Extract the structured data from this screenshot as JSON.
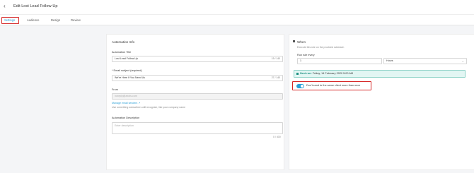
{
  "header": {
    "back_icon": "chevron-left-icon",
    "title": "Edit Lost Lead Follow-Up"
  },
  "tabs": [
    {
      "label": "Settings",
      "active": true
    },
    {
      "label": "Audience",
      "active": false
    },
    {
      "label": "Design",
      "active": false
    },
    {
      "label": "Review",
      "active": false
    }
  ],
  "info": {
    "section_title": "Automation Info",
    "automation_title_label": "Automation Title",
    "automation_title_value": "Lost Lead Follow-Up",
    "automation_title_counter": "19 / 140",
    "email_subject_label": "* Email subject (required)",
    "email_subject_value": "We're Here If You Need Us",
    "email_subject_counter": "27 / 140",
    "from_label": "From",
    "from_value": "noreply@zbots.com",
    "manage_link": "Manage email senders",
    "from_hint": "Use something subscribers will recognize, like your company name",
    "description_label": "Automation Description",
    "description_placeholder": "Enter description",
    "description_counter": "0 / 400"
  },
  "when": {
    "section_title": "When",
    "subtitle": "Execute this rule on the provided schedule.",
    "run_every_label": "Run rule every",
    "run_every_value": "1",
    "unit_value": "Hours",
    "next_run_prefix": "Next run:",
    "next_run_value": "Friday, 14 February 2020 5:00 AM",
    "toggle_on": true,
    "toggle_label": "Don't send to the same client more than once"
  },
  "colors": {
    "accent": "#2a9fd6",
    "highlight": "#d62828",
    "next_run_bg": "#e2f6f3"
  }
}
